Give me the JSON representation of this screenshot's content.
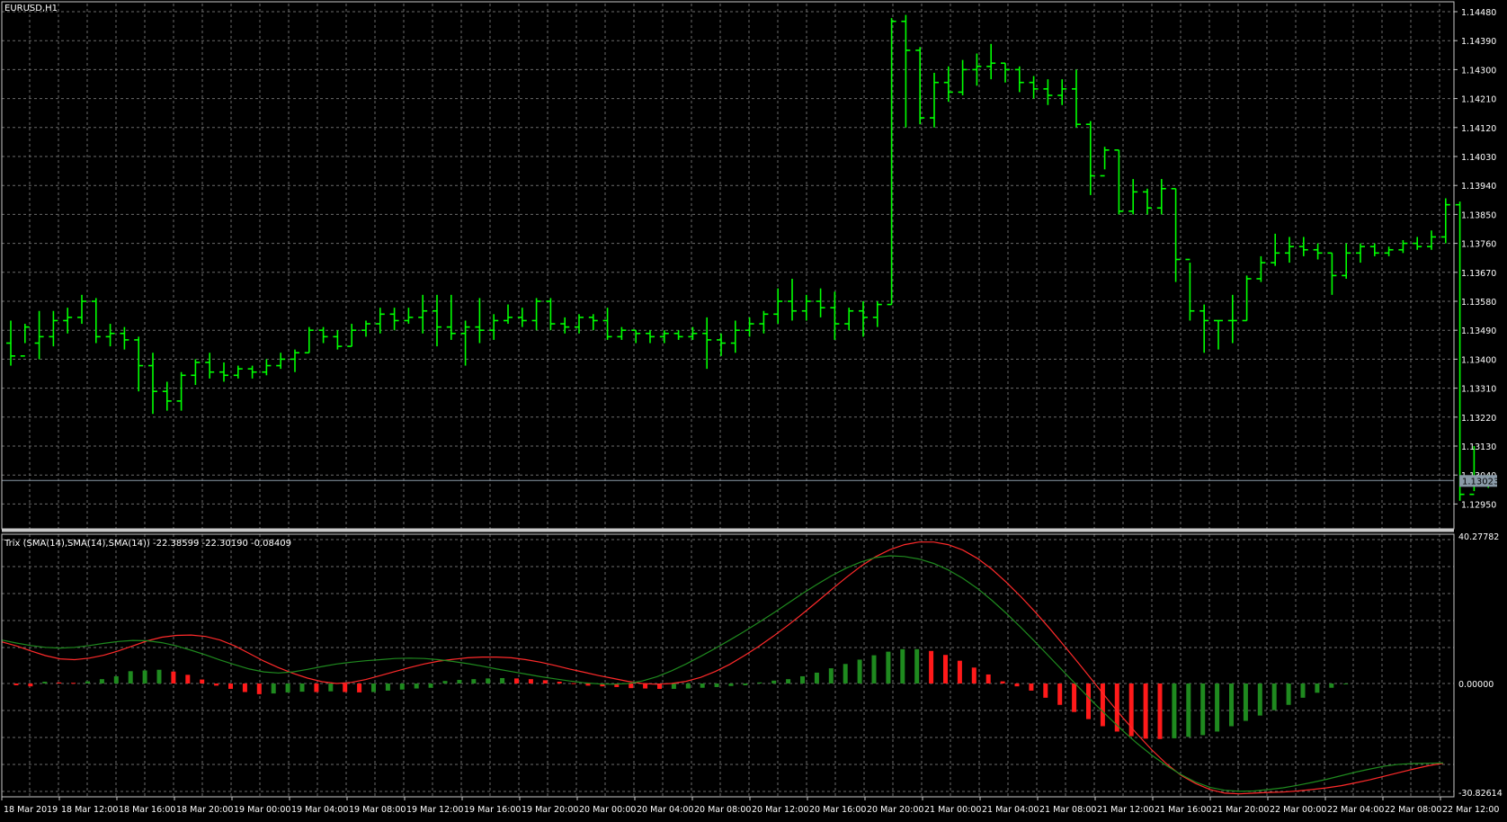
{
  "symbol_label": "EURUSD,H1",
  "indicator_label": "Trix (SMA(14),SMA(14),SMA(14)) -22.38599 -22.30190 -0.08409",
  "current_price_label": "1.13023",
  "colors": {
    "background": "#000000",
    "grid": "#6b6b6b",
    "frame": "#c8c8c8",
    "bars": "#00ff00",
    "trix_line": "#ff2a2a",
    "signal_line": "#1f8a1f",
    "hist_up": "#1f8a1f",
    "hist_down": "#ff1a1a",
    "text": "#ffffff",
    "price_tag": "#8a9aa8"
  },
  "price_axis_labels": [
    "1.14480",
    "1.14390",
    "1.14300",
    "1.14210",
    "1.14120",
    "1.14030",
    "1.13940",
    "1.13850",
    "1.13760",
    "1.13670",
    "1.13580",
    "1.13490",
    "1.13400",
    "1.13310",
    "1.13220",
    "1.13130",
    "1.13040",
    "1.12950"
  ],
  "indicator_axis_labels": [
    "40.27782",
    "0.00000",
    "-30.82614"
  ],
  "time_axis_labels": [
    "18 Mar 2019",
    "18 Mar 12:00",
    "18 Mar 16:00",
    "18 Mar 20:00",
    "19 Mar 00:00",
    "19 Mar 04:00",
    "19 Mar 08:00",
    "19 Mar 12:00",
    "19 Mar 16:00",
    "19 Mar 20:00",
    "20 Mar 00:00",
    "20 Mar 04:00",
    "20 Mar 08:00",
    "20 Mar 12:00",
    "20 Mar 16:00",
    "20 Mar 20:00",
    "21 Mar 00:00",
    "21 Mar 04:00",
    "21 Mar 08:00",
    "21 Mar 12:00",
    "21 Mar 16:00",
    "21 Mar 20:00",
    "22 Mar 00:00",
    "22 Mar 04:00",
    "22 Mar 08:00",
    "22 Mar 12:00"
  ],
  "chart_data": {
    "type": "ohlc_bar",
    "symbol": "EURUSD",
    "timeframe": "H1",
    "ylim": [
      1.1292,
      1.145
    ],
    "ohlc": [
      [
        1.1345,
        1.1352,
        1.1338,
        1.1341
      ],
      [
        1.1341,
        1.1351,
        1.1345,
        1.135
      ],
      [
        1.1345,
        1.1355,
        1.134,
        1.1347
      ],
      [
        1.1347,
        1.1355,
        1.1344,
        1.1352
      ],
      [
        1.1352,
        1.1356,
        1.1348,
        1.1353
      ],
      [
        1.1353,
        1.136,
        1.1351,
        1.1358
      ],
      [
        1.1358,
        1.1359,
        1.1345,
        1.1347
      ],
      [
        1.1347,
        1.1351,
        1.1344,
        1.1348
      ],
      [
        1.1348,
        1.135,
        1.1343,
        1.1346
      ],
      [
        1.1346,
        1.1347,
        1.133,
        1.1338
      ],
      [
        1.1338,
        1.1342,
        1.1323,
        1.133
      ],
      [
        1.133,
        1.1333,
        1.1324,
        1.1327
      ],
      [
        1.1327,
        1.1336,
        1.1324,
        1.1335
      ],
      [
        1.1335,
        1.134,
        1.1332,
        1.1339
      ],
      [
        1.1339,
        1.1342,
        1.1334,
        1.1336
      ],
      [
        1.1336,
        1.1339,
        1.1333,
        1.1335
      ],
      [
        1.1335,
        1.1338,
        1.1334,
        1.1337
      ],
      [
        1.1337,
        1.1338,
        1.1334,
        1.1336
      ],
      [
        1.1336,
        1.134,
        1.1335,
        1.1338
      ],
      [
        1.1338,
        1.1342,
        1.1337,
        1.134
      ],
      [
        1.134,
        1.1343,
        1.1336,
        1.1342
      ],
      [
        1.1342,
        1.135,
        1.1342,
        1.1349
      ],
      [
        1.1349,
        1.135,
        1.1345,
        1.1347
      ],
      [
        1.1347,
        1.1349,
        1.1343,
        1.1344
      ],
      [
        1.1344,
        1.1351,
        1.1344,
        1.1349
      ],
      [
        1.1349,
        1.1352,
        1.1347,
        1.1351
      ],
      [
        1.1351,
        1.1356,
        1.1348,
        1.1354
      ],
      [
        1.1354,
        1.1356,
        1.1349,
        1.1352
      ],
      [
        1.1352,
        1.1356,
        1.1351,
        1.1353
      ],
      [
        1.1353,
        1.136,
        1.1348,
        1.1355
      ],
      [
        1.1355,
        1.136,
        1.1344,
        1.135
      ],
      [
        1.135,
        1.136,
        1.1346,
        1.1348
      ],
      [
        1.1348,
        1.1352,
        1.1338,
        1.135
      ],
      [
        1.135,
        1.1359,
        1.1345,
        1.1349
      ],
      [
        1.1349,
        1.1354,
        1.1346,
        1.1352
      ],
      [
        1.1352,
        1.1357,
        1.1351,
        1.1353
      ],
      [
        1.1353,
        1.1356,
        1.135,
        1.1352
      ],
      [
        1.1352,
        1.1359,
        1.1349,
        1.1358
      ],
      [
        1.1358,
        1.1359,
        1.1349,
        1.1351
      ],
      [
        1.1351,
        1.1353,
        1.1348,
        1.135
      ],
      [
        1.135,
        1.1354,
        1.1348,
        1.1353
      ],
      [
        1.1353,
        1.1354,
        1.1349,
        1.1352
      ],
      [
        1.1352,
        1.1356,
        1.1346,
        1.1347
      ],
      [
        1.1347,
        1.135,
        1.1346,
        1.1349
      ],
      [
        1.1349,
        1.1349,
        1.1345,
        1.1348
      ],
      [
        1.1348,
        1.1349,
        1.1345,
        1.1347
      ],
      [
        1.1347,
        1.1349,
        1.1345,
        1.1348
      ],
      [
        1.1348,
        1.1349,
        1.1346,
        1.1347
      ],
      [
        1.1347,
        1.135,
        1.1346,
        1.1348
      ],
      [
        1.1348,
        1.1353,
        1.1337,
        1.1346
      ],
      [
        1.1346,
        1.1348,
        1.1341,
        1.1345
      ],
      [
        1.1345,
        1.1352,
        1.1342,
        1.1349
      ],
      [
        1.1349,
        1.1353,
        1.1347,
        1.1351
      ],
      [
        1.1351,
        1.1355,
        1.1348,
        1.1354
      ],
      [
        1.1354,
        1.1362,
        1.1351,
        1.1358
      ],
      [
        1.1358,
        1.1365,
        1.1352,
        1.1355
      ],
      [
        1.1355,
        1.136,
        1.1352,
        1.1358
      ],
      [
        1.1358,
        1.1362,
        1.1353,
        1.1356
      ],
      [
        1.1356,
        1.1361,
        1.1346,
        1.1351
      ],
      [
        1.1351,
        1.1356,
        1.1349,
        1.1355
      ],
      [
        1.1355,
        1.1358,
        1.1347,
        1.1353
      ],
      [
        1.1353,
        1.1358,
        1.135,
        1.1357
      ],
      [
        1.1357,
        1.1446,
        1.1357,
        1.1445
      ],
      [
        1.1445,
        1.1447,
        1.1412,
        1.1436
      ],
      [
        1.1436,
        1.1437,
        1.1413,
        1.1415
      ],
      [
        1.1415,
        1.1429,
        1.1412,
        1.1426
      ],
      [
        1.1426,
        1.1431,
        1.142,
        1.1423
      ],
      [
        1.1423,
        1.1433,
        1.1422,
        1.143
      ],
      [
        1.143,
        1.1435,
        1.1425,
        1.1431
      ],
      [
        1.1431,
        1.1438,
        1.1427,
        1.1432
      ],
      [
        1.1432,
        1.1432,
        1.1426,
        1.143
      ],
      [
        1.143,
        1.1431,
        1.1423,
        1.1426
      ],
      [
        1.1426,
        1.1428,
        1.1421,
        1.1424
      ],
      [
        1.1424,
        1.1427,
        1.1419,
        1.1422
      ],
      [
        1.1422,
        1.1427,
        1.1419,
        1.1424
      ],
      [
        1.1424,
        1.143,
        1.1412,
        1.1413
      ],
      [
        1.1413,
        1.1414,
        1.1391,
        1.1397
      ],
      [
        1.1397,
        1.1406,
        1.1399,
        1.1405
      ],
      [
        1.1405,
        1.1405,
        1.1385,
        1.1386
      ],
      [
        1.1386,
        1.1396,
        1.1385,
        1.1392
      ],
      [
        1.1392,
        1.1393,
        1.1385,
        1.1387
      ],
      [
        1.1387,
        1.1396,
        1.1385,
        1.1393
      ],
      [
        1.1393,
        1.1393,
        1.1364,
        1.1371
      ],
      [
        1.1371,
        1.137,
        1.1352,
        1.1355
      ],
      [
        1.1355,
        1.1357,
        1.1342,
        1.1352
      ],
      [
        1.1352,
        1.1352,
        1.1343,
        1.1352
      ],
      [
        1.1352,
        1.136,
        1.1345,
        1.1352
      ],
      [
        1.1352,
        1.1366,
        1.1352,
        1.1365
      ],
      [
        1.1365,
        1.1372,
        1.1364,
        1.137
      ],
      [
        1.137,
        1.1379,
        1.1369,
        1.1373
      ],
      [
        1.1373,
        1.1378,
        1.137,
        1.1375
      ],
      [
        1.1375,
        1.1378,
        1.1372,
        1.1374
      ],
      [
        1.1374,
        1.1376,
        1.1371,
        1.1373
      ],
      [
        1.1373,
        1.1373,
        1.136,
        1.1366
      ],
      [
        1.1366,
        1.1376,
        1.1365,
        1.1373
      ],
      [
        1.1373,
        1.1376,
        1.137,
        1.1375
      ],
      [
        1.1375,
        1.1376,
        1.1372,
        1.1373
      ],
      [
        1.1373,
        1.1375,
        1.1372,
        1.1374
      ],
      [
        1.1374,
        1.1377,
        1.1373,
        1.1376
      ],
      [
        1.1376,
        1.1378,
        1.1374,
        1.1375
      ],
      [
        1.1375,
        1.138,
        1.1374,
        1.1378
      ],
      [
        1.1378,
        1.139,
        1.1376,
        1.1388
      ],
      [
        1.1388,
        1.1389,
        1.1296,
        1.1298
      ],
      [
        1.1298,
        1.1313,
        1.1299,
        1.1303
      ],
      [
        1.1303,
        1.1304,
        1.13,
        1.13023
      ]
    ],
    "trix": [
      11.5,
      10.4,
      9.0,
      7.7,
      6.8,
      6.6,
      7.0,
      7.8,
      9.0,
      10.4,
      11.8,
      12.8,
      13.3,
      13.4,
      13.0,
      12.0,
      10.4,
      8.3,
      6.2,
      4.4,
      2.8,
      1.5,
      0.5,
      0.0,
      0.3,
      1.1,
      2.2,
      3.3,
      4.4,
      5.4,
      6.2,
      6.7,
      7.1,
      7.3,
      7.3,
      7.1,
      6.6,
      5.9,
      5.0,
      4.0,
      3.1,
      2.2,
      1.4,
      0.6,
      0.0,
      -0.2,
      0.0,
      0.6,
      1.7,
      3.3,
      5.3,
      7.7,
      10.3,
      13.1,
      16.1,
      19.3,
      22.6,
      26.0,
      29.3,
      32.4,
      35.0,
      37.0,
      38.4,
      39.1,
      39.1,
      38.4,
      36.9,
      34.6,
      31.6,
      28.0,
      24.0,
      19.7,
      15.1,
      10.3,
      5.4,
      0.4,
      -4.7,
      -9.6,
      -14.3,
      -18.7,
      -22.6,
      -25.8,
      -28.1,
      -29.8,
      -30.8,
      -31.0,
      -30.8,
      -30.6,
      -30.5,
      -30.2,
      -29.8,
      -29.3,
      -28.7,
      -27.9,
      -27.0,
      -26.0,
      -25.0,
      -24.0,
      -23.1,
      -22.39
    ],
    "signal": [
      12.0,
      11.2,
      10.5,
      10.0,
      9.8,
      10.0,
      10.5,
      11.1,
      11.6,
      11.9,
      11.8,
      11.3,
      10.4,
      9.2,
      7.9,
      6.5,
      5.2,
      4.0,
      3.2,
      2.9,
      3.2,
      3.9,
      4.7,
      5.4,
      5.9,
      6.3,
      6.6,
      6.9,
      7.0,
      6.9,
      6.6,
      6.1,
      5.5,
      4.8,
      4.0,
      3.3,
      2.6,
      1.9,
      1.3,
      0.7,
      0.2,
      -0.1,
      -0.2,
      0.0,
      0.7,
      1.9,
      3.5,
      5.4,
      7.5,
      9.7,
      12.0,
      14.4,
      16.9,
      19.5,
      22.2,
      24.9,
      27.4,
      29.8,
      31.9,
      33.6,
      34.8,
      35.3,
      35.1,
      34.4,
      33.2,
      31.4,
      29.1,
      26.3,
      23.0,
      19.4,
      15.5,
      11.4,
      7.2,
      3.0,
      -1.2,
      -5.4,
      -9.4,
      -13.3,
      -16.9,
      -20.2,
      -23.1,
      -25.6,
      -27.7,
      -29.2,
      -30.0,
      -30.3,
      -30.2,
      -29.8,
      -29.3,
      -28.6,
      -27.8,
      -26.9,
      -25.9,
      -24.9,
      -24.0,
      -23.2,
      -22.7,
      -22.5,
      -22.4,
      -22.3
    ],
    "histogram": [
      -0.5,
      -0.8,
      0.5,
      0.3,
      0.2,
      0.6,
      1.2,
      2.0,
      3.4,
      3.6,
      3.8,
      3.3,
      2.4,
      1.1,
      -0.6,
      -1.5,
      -2.4,
      -3.0,
      -2.8,
      -2.5,
      -2.3,
      -2.4,
      -2.2,
      -2.4,
      -2.5,
      -2.4,
      -2.0,
      -1.7,
      -1.4,
      -1.2,
      0.7,
      1.0,
      1.2,
      1.4,
      1.5,
      1.4,
      1.2,
      0.9,
      0.5,
      0.1,
      -0.6,
      -0.8,
      -1.0,
      -1.3,
      -1.4,
      -1.5,
      -1.5,
      -1.4,
      -1.2,
      -1.0,
      -0.7,
      -0.5,
      0.3,
      0.8,
      1.2,
      2.0,
      3.0,
      4.2,
      5.4,
      6.6,
      7.8,
      8.8,
      9.5,
      9.5,
      9.0,
      7.9,
      6.3,
      4.4,
      2.5,
      0.6,
      -0.8,
      -2.0,
      -4.0,
      -6.0,
      -8.0,
      -10.0,
      -12.0,
      -13.5,
      -14.8,
      -15.5,
      -15.6,
      -15.4,
      -15.0,
      -14.5,
      -13.5,
      -12.0,
      -10.5,
      -9.0,
      -7.5,
      -6.0,
      -4.0,
      -2.6,
      -1.2,
      -0.08
    ],
    "indicator_ylim": [
      -30.82614,
      40.27782
    ]
  }
}
